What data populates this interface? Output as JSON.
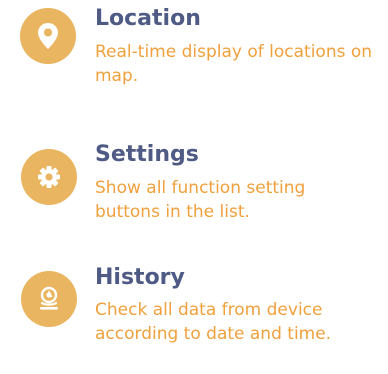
{
  "features": [
    {
      "icon": "location-pin-icon",
      "title": "Location",
      "description": "Real-time display of locations on map."
    },
    {
      "icon": "gear-icon",
      "title": "Settings",
      "description": "Show all function setting buttons in the list."
    },
    {
      "icon": "history-icon",
      "title": "History",
      "description": "Check all data from device according to date and time."
    }
  ],
  "colors": {
    "icon_background": "#eab560",
    "title": "#4f5a85",
    "description": "#f0a03c"
  }
}
